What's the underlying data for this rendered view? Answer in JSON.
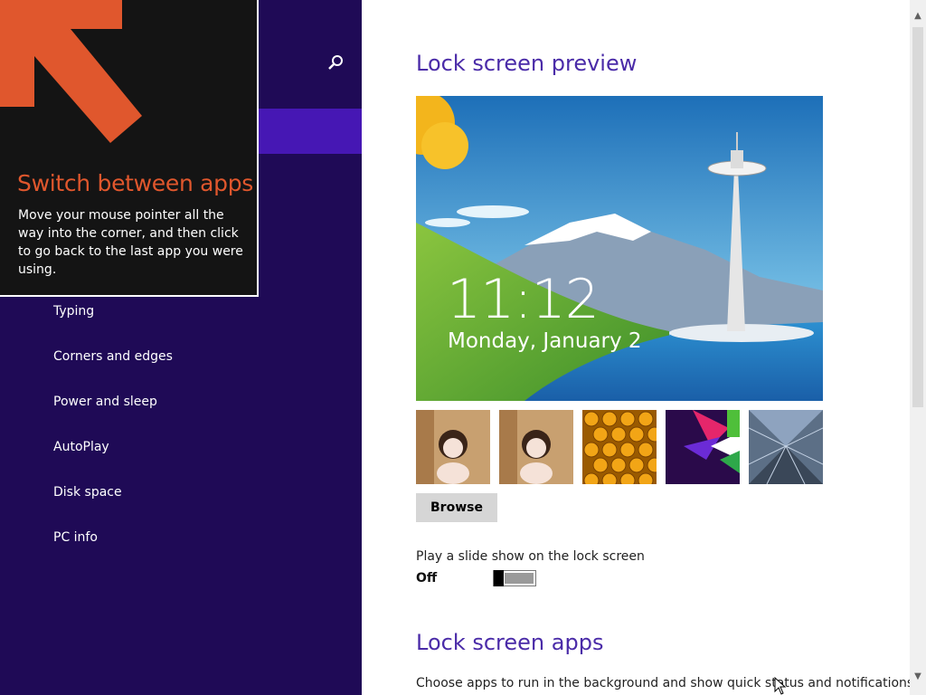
{
  "nav": {
    "items": [
      {
        "label": "Typing"
      },
      {
        "label": "Corners and edges"
      },
      {
        "label": "Power and sleep"
      },
      {
        "label": "AutoPlay"
      },
      {
        "label": "Disk space"
      },
      {
        "label": "PC info"
      }
    ],
    "search_icon": "search-icon",
    "colors": {
      "background": "#1f0a56",
      "selected": "#4617b4"
    }
  },
  "tip": {
    "title": "Switch between apps",
    "body": "Move your mouse pointer all the way into the corner, and then click to go back to the last app you were using.",
    "arrow_icon": "arrow-up-left-icon",
    "colors": {
      "title": "#e0572d",
      "arrow": "#e0572d",
      "background": "#141414"
    }
  },
  "main": {
    "preview_title": "Lock screen preview",
    "preview": {
      "time": "11:12",
      "date": "Monday, January 2"
    },
    "thumbnails": [
      {
        "name": "cartoon-girl-wallpaper-1"
      },
      {
        "name": "cartoon-girl-wallpaper-2"
      },
      {
        "name": "honeycomb-wallpaper"
      },
      {
        "name": "abstract-color-wallpaper"
      },
      {
        "name": "subway-tunnel-wallpaper"
      }
    ],
    "browse_label": "Browse",
    "slideshow_label": "Play a slide show on the lock screen",
    "slideshow_state": "Off",
    "apps_title": "Lock screen apps",
    "apps_description": "Choose apps to run in the background and show quick status and notifications,",
    "colors": {
      "title": "#4a2ba8"
    }
  },
  "scrollbar": {
    "up_icon": "scroll-up-arrow-icon",
    "down_icon": "scroll-down-arrow-icon"
  }
}
